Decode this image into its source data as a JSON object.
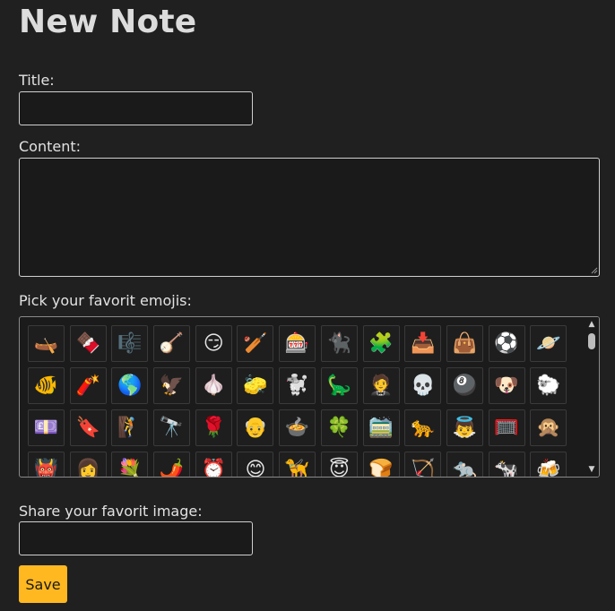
{
  "form": {
    "heading": "New Note",
    "title_label": "Title:",
    "title_value": "",
    "content_label": "Content:",
    "content_value": "",
    "emoji_label": "Pick your favorit emojis:",
    "image_label": "Share your favorit image:",
    "image_value": "",
    "save_label": "Save"
  },
  "emojis": [
    "🛶",
    "🍫",
    "🎼",
    "🪕",
    "😏",
    "🏏",
    "🎰",
    "🐈‍⬛",
    "🧩",
    "📥",
    "👜",
    "⚽",
    "🪐",
    "🐠",
    "🧨",
    "🌎",
    "🦅",
    "🧄",
    "🧽",
    "🐩",
    "🦕",
    "🤵",
    "💀",
    "🎱",
    "🐶",
    "🐑",
    "💷",
    "🔖",
    "🧗",
    "🔭",
    "🌹",
    "👴",
    "🍲",
    "🍀",
    "🚞",
    "🐆",
    "👼",
    "🥅",
    "🙊",
    "👹",
    "👩",
    "💐",
    "🌶️",
    "⏰",
    "😊",
    "🦮",
    "😇",
    "🍞",
    "🏹",
    "🐀",
    "🐄",
    "🍻"
  ],
  "colors": {
    "background": "#202020",
    "accent": "#ffb81f"
  }
}
